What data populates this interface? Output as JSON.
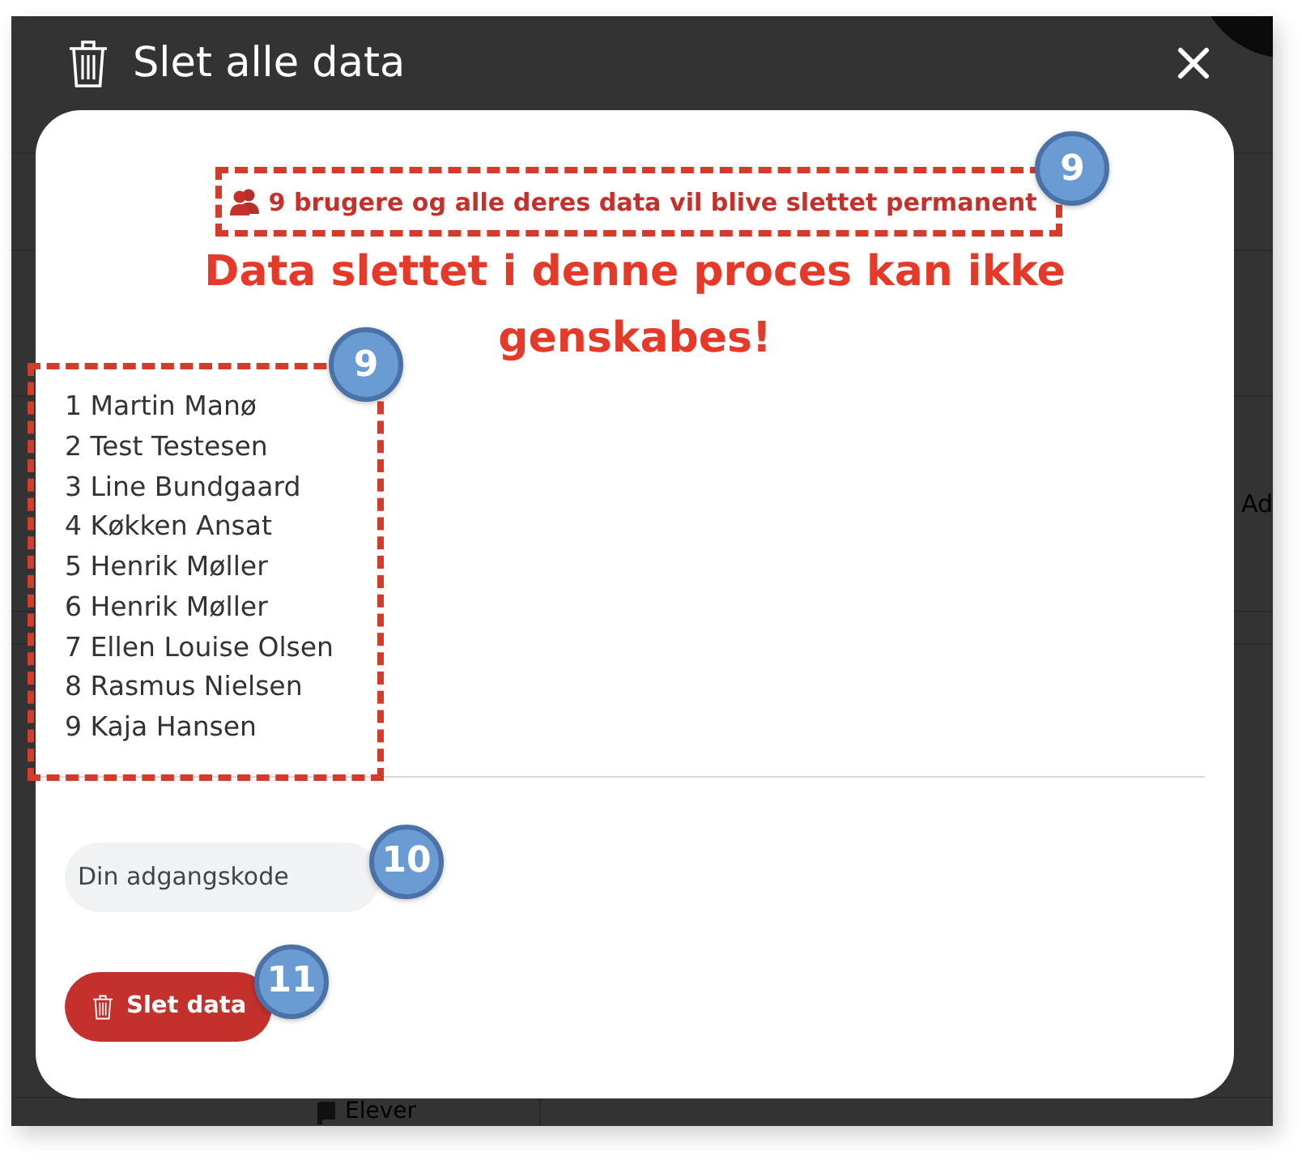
{
  "background": {
    "side_text": "Ad",
    "nav_item": "Elever"
  },
  "dialog": {
    "title": "Slet alle data",
    "warning": {
      "text": "9 brugere og alle deres data vil blive slettet permanent",
      "callout": {
        "label": "9",
        "framed": true
      }
    },
    "heading": [
      "Data slettet i denne proces kan ikke",
      "genskabes!"
    ],
    "users": {
      "items": [
        "1 Martin Manø",
        "2 Test Testesen",
        "3 Line Bundgaard",
        "4 Køkken Ansat",
        "5 Henrik Møller",
        "6 Henrik Møller",
        "7 Ellen Louise Olsen",
        "8 Rasmus Nielsen",
        "9 Kaja Hansen"
      ],
      "callout": {
        "label": "9",
        "framed": true
      }
    },
    "password": {
      "placeholder": "Din adgangskode",
      "callout": {
        "label": "10"
      }
    },
    "delete_button": {
      "label": "Slet data",
      "callout": {
        "label": "11"
      }
    }
  }
}
